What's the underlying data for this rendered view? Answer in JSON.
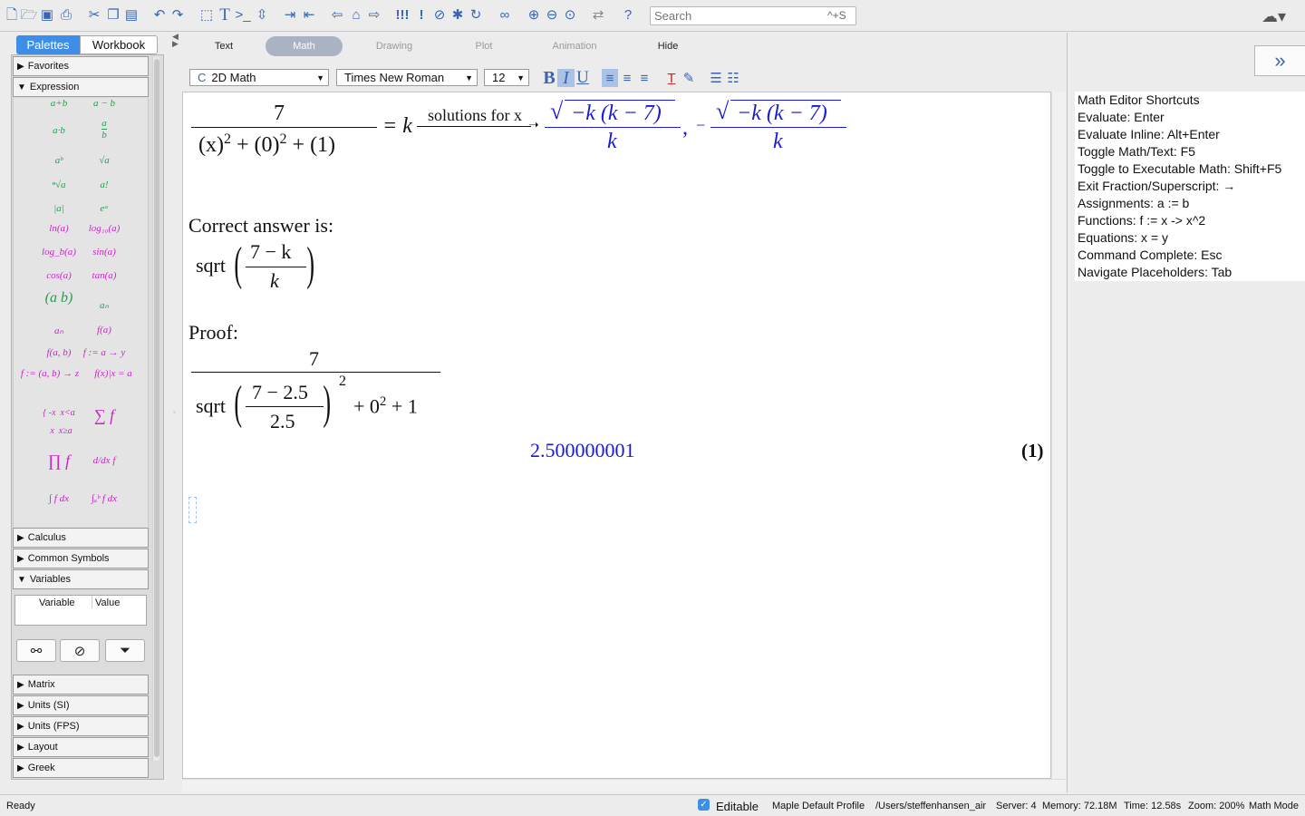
{
  "toolbar": {
    "search_placeholder": "Search",
    "search_shortcut": "^+S"
  },
  "palette_tabs": [
    "Palettes",
    "Workbook"
  ],
  "palettes": {
    "favorites": "Favorites",
    "expression": "Expression",
    "calculus": "Calculus",
    "common_symbols": "Common Symbols",
    "variables": "Variables",
    "matrix": "Matrix",
    "units_si": "Units (SI)",
    "units_fps": "Units (FPS)",
    "layout": "Layout",
    "greek": "Greek"
  },
  "expression_items": [
    "a+b",
    "a − b",
    "a·b",
    "a/b",
    "aᵇ",
    "√a",
    "ⁿ√a",
    "a!",
    "|a|",
    "eᵃ",
    "ln(a)",
    "log₁₀(a)",
    "log_b(a)",
    "sin(a)",
    "cos(a)",
    "tan(a)",
    "(a b)",
    "aₙ",
    "aₙ",
    "f(a)",
    "f(a, b)",
    "f := a → y",
    "f := (a, b) → z",
    "f(x)|x = a",
    "piecewise",
    "∑ f",
    "∏ f",
    "d/dx f",
    "∫ f dx",
    "∫ₐᵇ f dx"
  ],
  "variables_table": {
    "col_variable": "Variable",
    "col_value": "Value"
  },
  "context_tabs": [
    "Text",
    "Math",
    "Drawing",
    "Plot",
    "Animation",
    "Hide"
  ],
  "format": {
    "style": "2D Math",
    "font": "Times New Roman",
    "size": "12"
  },
  "document": {
    "eq1_num": "7",
    "eq1_den_a": "(x)",
    "eq1_den_b": "(0)",
    "eq1_den_c": "(1)",
    "eq1_sup": "2",
    "eq1_eq": "= k",
    "eq1_arrow_label": "solutions for x",
    "sol_rad": "−k (k − 7)",
    "sol_den": "k",
    "sol_sep": ",",
    "sol_neg": "−",
    "correct_label": "Correct answer is:",
    "sqrt_fn": "sqrt",
    "ans_num": "7 − k",
    "ans_den": "k",
    "proof_label": "Proof:",
    "proof_num": "7",
    "proof_inner_num": "7 − 2.5",
    "proof_inner_den": "2.5",
    "proof_tail": "+ 0",
    "proof_tail2": "+ 1",
    "result": "2.500000001",
    "eq_label": "(1)"
  },
  "shortcuts": [
    "Math Editor Shortcuts",
    "Evaluate:  Enter",
    "Evaluate Inline:  Alt+Enter",
    "Toggle Math/Text:  F5",
    "Toggle to Executable Math:  Shift+F5",
    "Exit Fraction/Superscript:  →",
    "Assignments:  a := b",
    "Functions:  f := x -> x^2",
    "Equations:  x = y",
    "Command Complete:  Esc",
    "Navigate Placeholders:  Tab"
  ],
  "status": {
    "state": "Ready",
    "editable": "Editable",
    "profile": "Maple Default Profile",
    "path": "/Users/steffenhansen_air",
    "server": "Server: 4",
    "memory": "Memory: 72.18M",
    "time": "Time: 12.58s",
    "zoom": "Zoom: 200%",
    "mode": "Math Mode"
  },
  "colors": {
    "accent": "#3d8ee8",
    "output": "#1a1ad6",
    "palette_green": "#2b9a55",
    "palette_magenta": "#c826c8"
  }
}
